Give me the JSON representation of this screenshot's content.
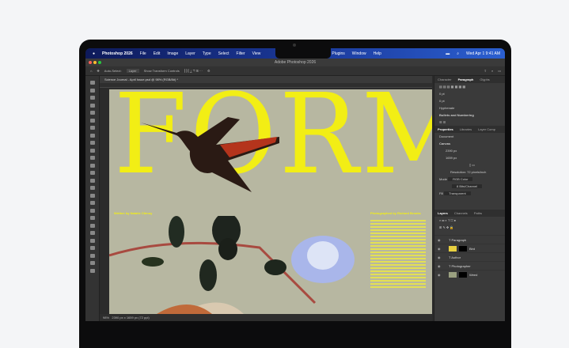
{
  "menubar": {
    "app": "Photoshop 2026",
    "items": [
      "File",
      "Edit",
      "Image",
      "Layer",
      "Type",
      "Select",
      "Filter",
      "View"
    ],
    "right_items": [
      "Plugins",
      "Window",
      "Help"
    ],
    "clock": "Wed Apr 1  9:41 AM"
  },
  "window": {
    "title": "Adobe Photoshop 2026"
  },
  "options": {
    "auto_select": "Auto-Select:",
    "layer": "Layer",
    "transform": "Show Transform Controls"
  },
  "document": {
    "tab": "Science Journal - April Issue.psd @ 98% (RGB/8#) *",
    "headline": "FORM",
    "byline_left": "Written by Natalie Chinoy",
    "byline_right": "Photographed by Richard Brooks"
  },
  "status": {
    "zoom": "98%",
    "size": "2390 px x 1659 px (72 ppi)"
  },
  "panels": {
    "top_tabs": [
      "Character",
      "Paragraph",
      "Glyphs"
    ],
    "top_active": 1,
    "paragraph": {
      "indent": "0 pt",
      "space": "0 pt",
      "hyphenate": "Hyphenate",
      "bullets": "Bullets and Numbering"
    },
    "mid_tabs": [
      "Properties",
      "Libraries",
      "Layer Comp"
    ],
    "properties": {
      "doc": "Document",
      "canvas": "Canvas",
      "w": "2390 px",
      "h": "1659 px",
      "resolution": "Resolution: 72 pixels/inch",
      "mode_label": "Mode",
      "mode": "RGB Color",
      "depth": "8 Bits/Channel",
      "fill_label": "Fill",
      "fill": "Transparent"
    },
    "layer_tabs": [
      "Layers",
      "Channels",
      "Paths"
    ],
    "layers": [
      "Paragraph",
      "Bird",
      "Author",
      "Photographer",
      "Weed"
    ]
  }
}
